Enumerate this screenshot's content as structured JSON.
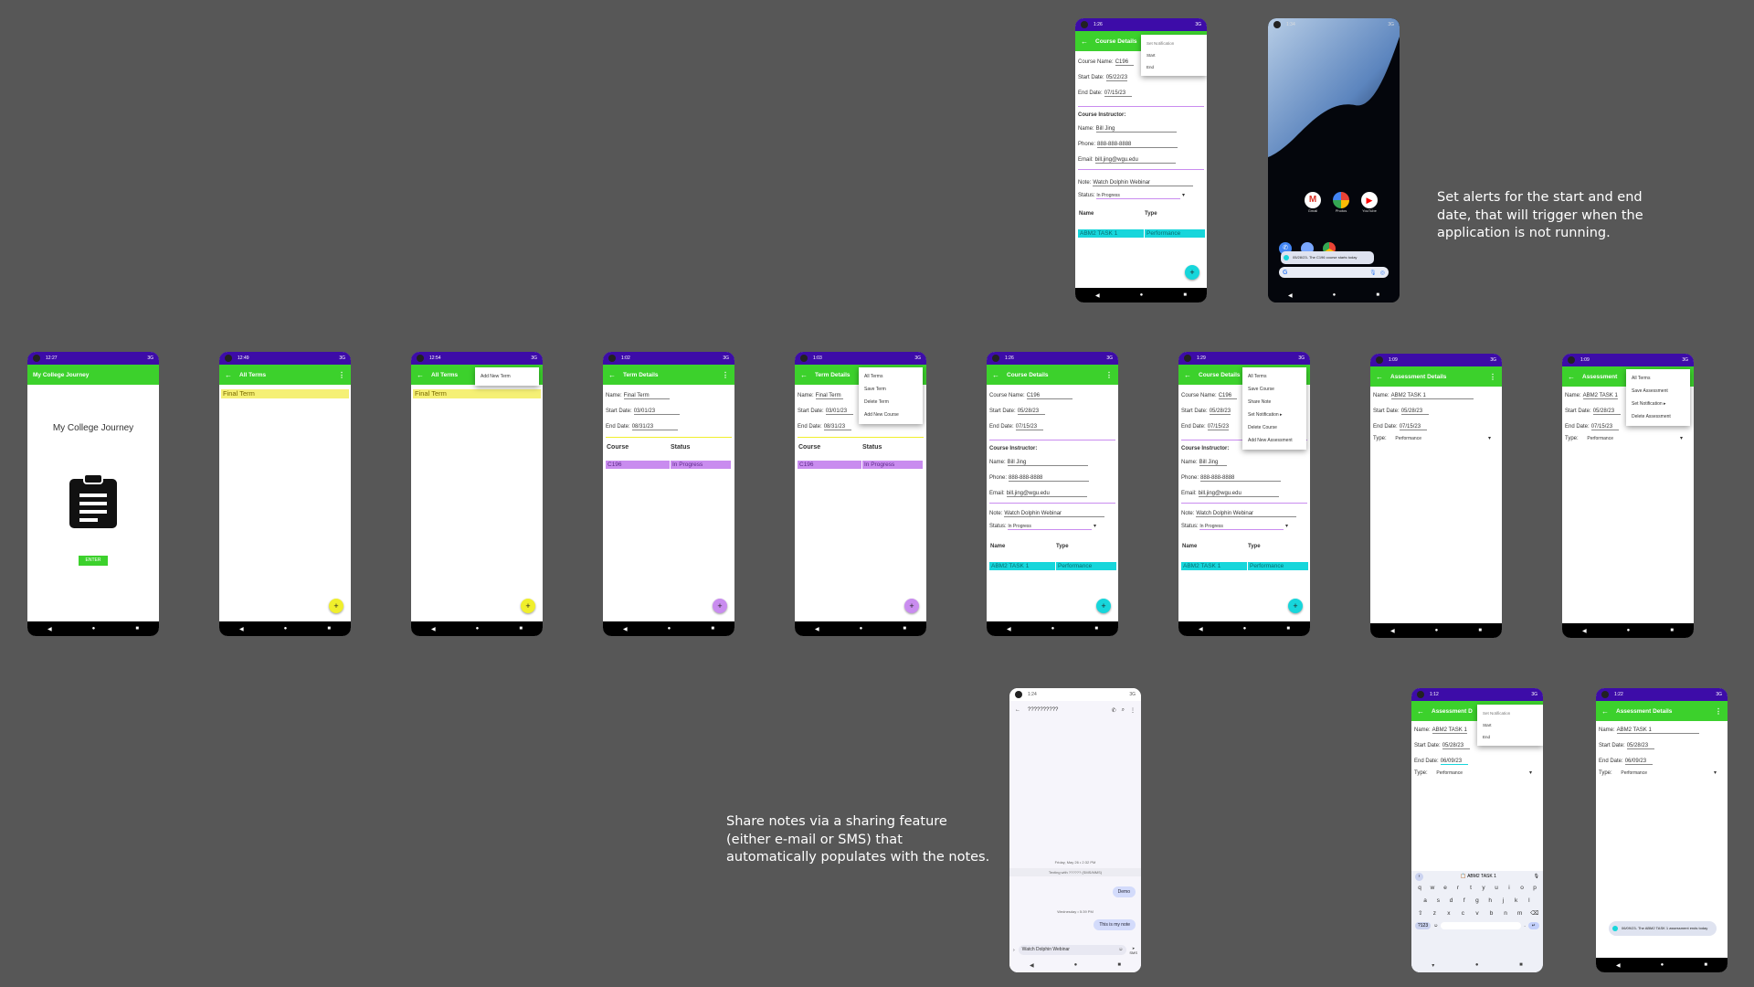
{
  "captions": {
    "alerts": "Set alerts for the start and end date, that will trigger when the application is not running.",
    "share": "Share notes via a sharing feature (either e-mail or SMS) that automatically populates with the notes."
  },
  "colors": {
    "status_bar": "#3d0ca8",
    "app_bar": "#3cd12c",
    "term_highlight": "#f5f075",
    "course_highlight": "#c98cef",
    "assessment_highlight": "#17d6db",
    "fab_yellow": "#f0ef2c",
    "fab_purple": "#c98cef",
    "fab_cyan": "#17d6db"
  },
  "home": {
    "time": "12:27",
    "net": "3G",
    "app_title": "My College Journey",
    "heading": "My College Journey",
    "icon": "clipboard-icon",
    "enter_label": "ENTER"
  },
  "all_terms": {
    "time": "12:49",
    "net": "3G",
    "title": "All Terms",
    "term": "Final Term"
  },
  "all_terms_menu": {
    "time": "12:54",
    "net": "3G",
    "title": "All Terms",
    "term": "Final Term",
    "menu": [
      "Add New Term"
    ]
  },
  "term_details": {
    "time": "1:02",
    "net": "3G",
    "title": "Term Details",
    "name_label": "Name:",
    "name": "Final Term",
    "start_label": "Start Date:",
    "start": "03/01/23",
    "end_label": "End Date:",
    "end": "08/31/23",
    "col_course": "Course",
    "col_status": "Status",
    "course": "C196",
    "status": "In Progress"
  },
  "term_menu": {
    "time": "1:03",
    "net": "3G",
    "title": "Term Details",
    "menu": [
      "All Terms",
      "Save Term",
      "Delete Term",
      "Add New Course"
    ]
  },
  "course_details": {
    "time": "1:26",
    "net": "3G",
    "title": "Course Details",
    "name_label": "Course Name:",
    "name": "C196",
    "start_label": "Start Date:",
    "start": "05/28/23",
    "end_label": "End Date:",
    "end": "07/15/23",
    "instructor_heading": "Course Instructor:",
    "inst_name_label": "Name:",
    "inst_name": "Bill Jing",
    "phone_label": "Phone:",
    "phone": "888-888-8888",
    "email_label": "Email:",
    "email": "bill.jing@wgu.edu",
    "note_label": "Note:",
    "note": "Watch Dolphin Webinar",
    "status_label": "Status:",
    "status": "In Progress",
    "col_name": "Name",
    "col_type": "Type",
    "assessment": "ABM2 TASK 1",
    "type": "Performance"
  },
  "course_menu": {
    "time": "1:29",
    "net": "3G",
    "title": "Course Details",
    "menu": [
      "All Terms",
      "Save Course",
      "Share Note",
      "Set Notification",
      "Delete Course",
      "Add New Assessment"
    ]
  },
  "course_top": {
    "time": "1:26",
    "net": "3G",
    "title": "Course Details",
    "start": "05/22/23",
    "menu": [
      "Set Notification",
      "Start",
      "End"
    ]
  },
  "homescreen": {
    "time": "1:34",
    "net": "3G",
    "apps": [
      "Gmail",
      "Photos",
      "YouTube"
    ],
    "notification": "05/28/23- The C196 course starts today"
  },
  "assess_details": {
    "time": "1:09",
    "net": "3G",
    "title": "Assessment Details",
    "name_label": "Name:",
    "name": "ABM2 TASK 1",
    "start_label": "Start Date:",
    "start": "05/28/23",
    "end_label": "End Date:",
    "end": "07/15/23",
    "type_label": "Type:",
    "type": "Performance"
  },
  "assess_menu": {
    "time": "1:09",
    "net": "3G",
    "title": "Assessment",
    "menu": [
      "All Terms",
      "Save Assessment",
      "Set Notification",
      "Delete Assessment"
    ]
  },
  "messages": {
    "time": "1:24",
    "net": "3G",
    "contact": "??????????",
    "date1": "Friday, May 26 • 2:32 PM",
    "texting": "Texting with ?????? (SMS/MMS)",
    "bubble1": "Demo",
    "date2": "Wednesday • 5:39 PM",
    "bubble2": "This is my note",
    "compose": "Watch Dolphin Webinar",
    "send": "SMS"
  },
  "assess_kbd": {
    "time": "1:12",
    "net": "3G",
    "title": "Assessment D",
    "name": "ABM2 TASK 1",
    "start": "05/28/23",
    "end": "06/09/23",
    "type": "Performance",
    "menu": [
      "Set Notification",
      "Start",
      "End"
    ],
    "suggest": "ABM2 TASK 1",
    "row1": [
      "q",
      "w",
      "e",
      "r",
      "t",
      "y",
      "u",
      "i",
      "o",
      "p"
    ],
    "row2": [
      "a",
      "s",
      "d",
      "f",
      "g",
      "h",
      "j",
      "k",
      "l"
    ],
    "row3": [
      "z",
      "x",
      "c",
      "v",
      "b",
      "n",
      "m"
    ],
    "sym": "?123"
  },
  "assess_notify": {
    "time": "1:22",
    "net": "3G",
    "title": "Assessment Details",
    "name": "ABM2 TASK 1",
    "start": "05/28/23",
    "end": "06/09/23",
    "type": "Performance",
    "toast": "06/09/23- The ABM2 TASK 1 assessment ends today"
  }
}
